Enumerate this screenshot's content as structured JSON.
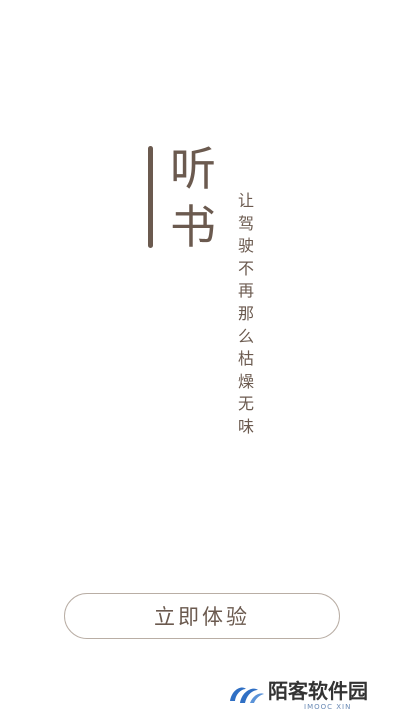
{
  "title": {
    "line1": "听",
    "line2": "书"
  },
  "slogan": {
    "chars": [
      "让",
      "驾",
      "驶",
      "不",
      "再",
      "那",
      "么",
      "枯",
      "燥",
      "无",
      "味"
    ]
  },
  "cta": {
    "label": "立即体验"
  },
  "watermark": {
    "text": "陌客软件园",
    "subtext": "IMOOC XIN",
    "logo_icon": "double-swoosh-logo-icon"
  },
  "colors": {
    "accent": "#6b5a4f",
    "background": "#ffffff",
    "button_border": "#b9aea5",
    "logo_blue": "#2f6fc4"
  }
}
